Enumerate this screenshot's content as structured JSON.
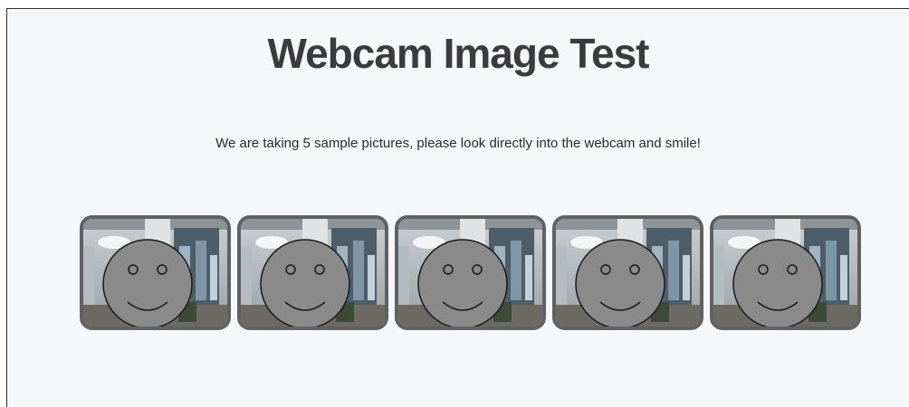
{
  "page": {
    "title": "Webcam Image Test",
    "instructions": "We are taking 5 sample pictures, please look directly into the webcam and smile!"
  },
  "samples": [
    {
      "icon": "smiley-face-icon"
    },
    {
      "icon": "smiley-face-icon"
    },
    {
      "icon": "smiley-face-icon"
    },
    {
      "icon": "smiley-face-icon"
    },
    {
      "icon": "smiley-face-icon"
    }
  ],
  "colors": {
    "background": "#f6f7f9",
    "title": "#3b3b3d",
    "thumb_border": "#5f6164",
    "face_fill": "#8a8a8a"
  }
}
